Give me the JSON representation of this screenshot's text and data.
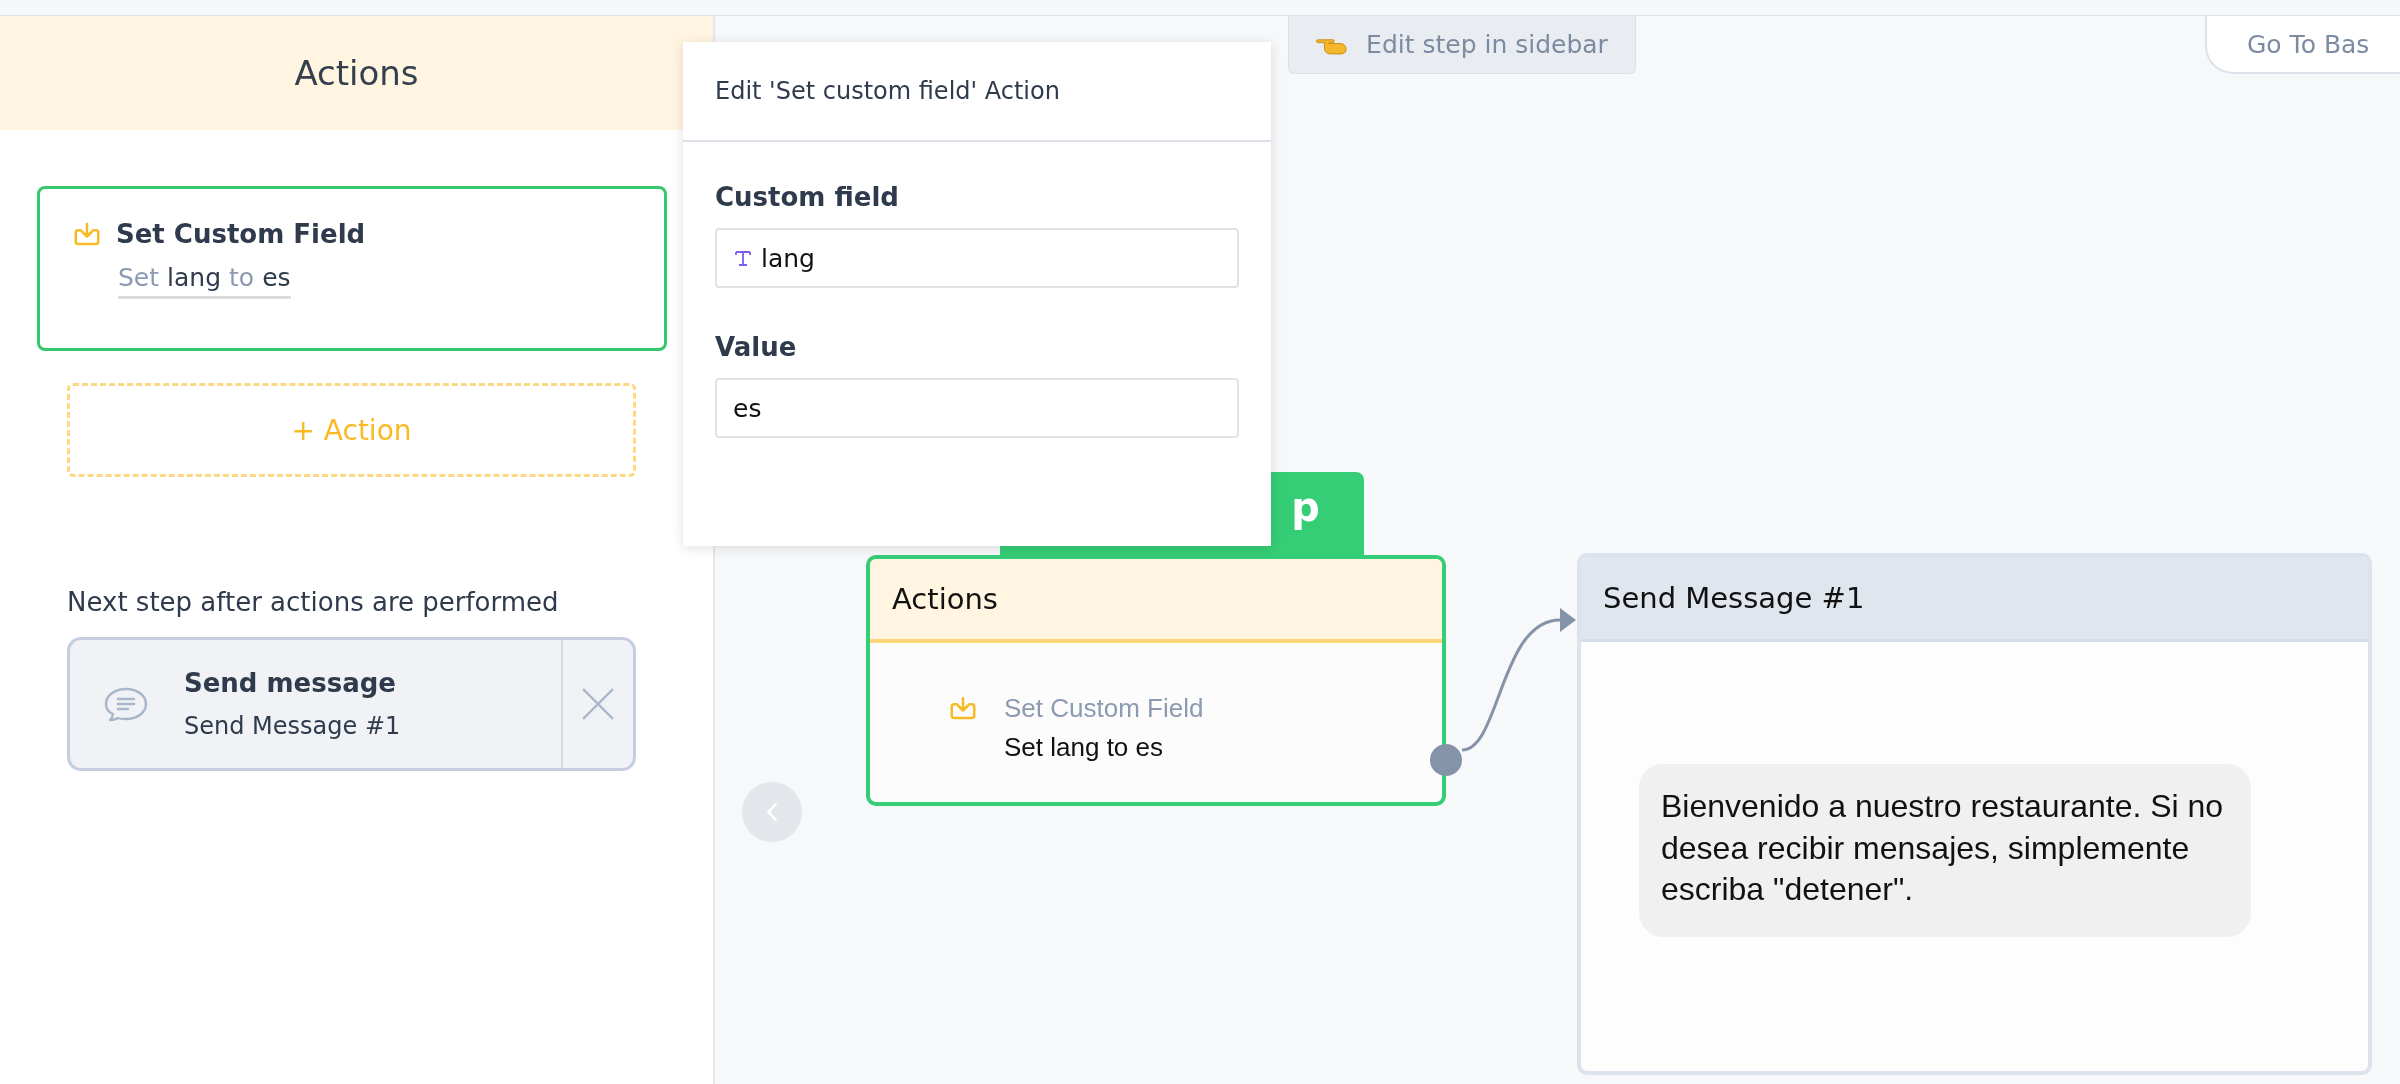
{
  "top_tab": {
    "label": "Edit step in sidebar"
  },
  "go_to_button": {
    "label": "Go To Bas"
  },
  "sidebar": {
    "title": "Actions",
    "actions": [
      {
        "title": "Set Custom Field",
        "selected": true,
        "summary": [
          {
            "text": "Set",
            "kind": "keyword"
          },
          {
            "text": "lang",
            "kind": "value"
          },
          {
            "text": "to",
            "kind": "keyword"
          },
          {
            "text": "es",
            "kind": "value"
          }
        ]
      }
    ],
    "add_button": "+ Action",
    "next_step": {
      "heading": "Next step after actions are performed",
      "title": "Send message",
      "subtitle": "Send Message #1"
    }
  },
  "popup": {
    "title": "Edit 'Set custom field' Action",
    "fields": [
      {
        "label": "Custom field",
        "value": "lang",
        "kind": "variable"
      },
      {
        "label": "Value",
        "value": "es",
        "kind": "text"
      }
    ]
  },
  "canvas": {
    "start_tab": {
      "label": "p"
    },
    "nodes": [
      {
        "kind": "actions",
        "title": "Actions",
        "selected": true,
        "items": [
          {
            "title": "Set Custom Field",
            "text": "Set lang to es"
          }
        ]
      },
      {
        "kind": "message",
        "title": "Send Message #1",
        "message": "Bienvenido a nuestro restaurante. Si no desea recibir mensajes, simplemente escriba \"detener\"."
      }
    ]
  }
}
